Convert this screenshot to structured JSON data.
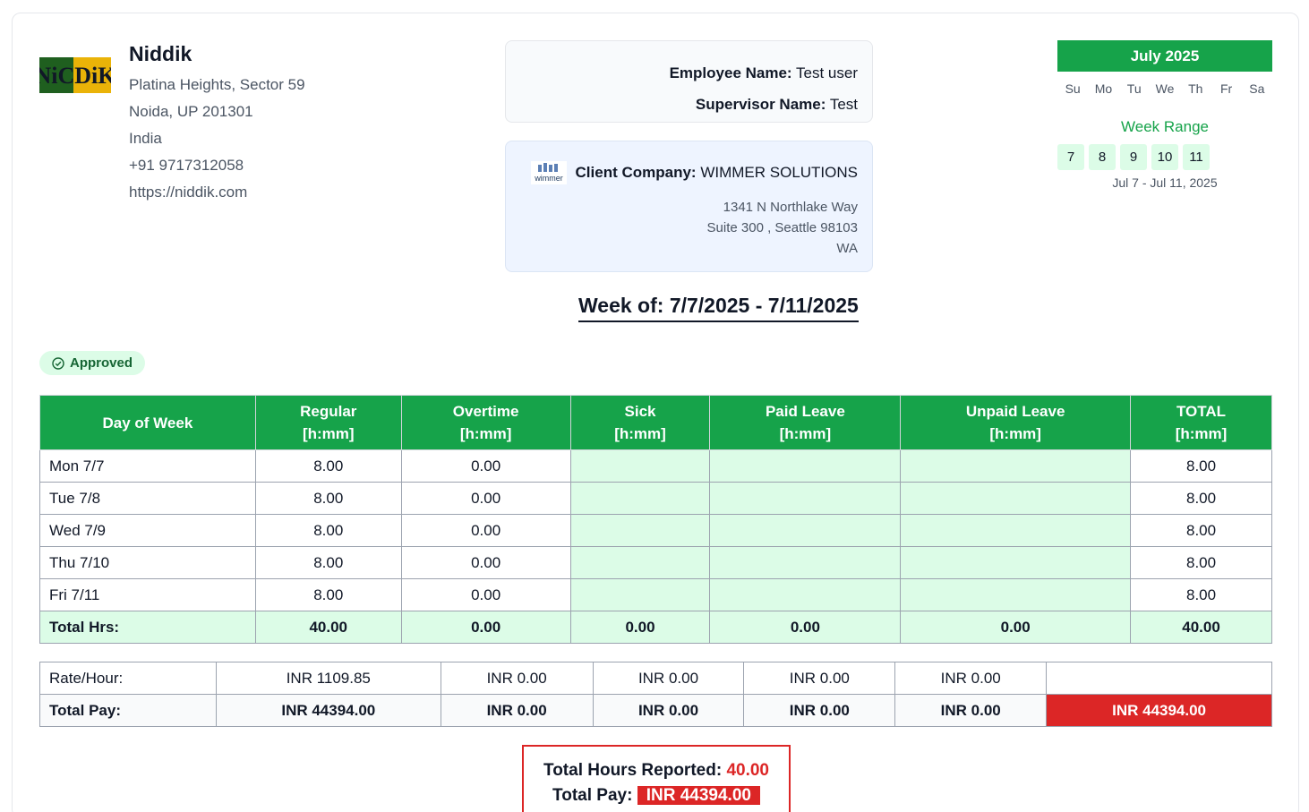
{
  "company": {
    "logo_text": "NiCDiK",
    "name": "Niddik",
    "address_line1": "Platina Heights, Sector 59",
    "address_line2": "Noida, UP 201301",
    "country": "India",
    "phone": "+91 9717312058",
    "website": "https://niddik.com"
  },
  "employee": {
    "employee_label": "Employee Name:",
    "employee_name": "Test user",
    "supervisor_label": "Supervisor Name:",
    "supervisor_name": "Test"
  },
  "client": {
    "logo_text": "wimmer",
    "label": "Client Company:",
    "name": "WIMMER SOLUTIONS",
    "address_line1": "1341 N Northlake Way",
    "address_line2": "Suite 300 , Seattle 98103",
    "address_line3": "WA"
  },
  "week_title": "Week of: 7/7/2025 - 7/11/2025",
  "calendar": {
    "month": "July 2025",
    "weekdays": [
      "Su",
      "Mo",
      "Tu",
      "We",
      "Th",
      "Fr",
      "Sa"
    ],
    "week_range_label": "Week Range",
    "dates": [
      "7",
      "8",
      "9",
      "10",
      "11"
    ],
    "range_text": "Jul 7 - Jul 11, 2025"
  },
  "status": {
    "label": "Approved",
    "icon": "check-circle-icon",
    "color": "#16a34a"
  },
  "hours_table": {
    "headers": [
      {
        "l1": "Day of Week",
        "l2": ""
      },
      {
        "l1": "Regular",
        "l2": "[h:mm]"
      },
      {
        "l1": "Overtime",
        "l2": "[h:mm]"
      },
      {
        "l1": "Sick",
        "l2": "[h:mm]"
      },
      {
        "l1": "Paid Leave",
        "l2": "[h:mm]"
      },
      {
        "l1": "Unpaid Leave",
        "l2": "[h:mm]"
      },
      {
        "l1": "TOTAL",
        "l2": "[h:mm]"
      }
    ],
    "rows": [
      {
        "day": "Mon 7/7",
        "regular": "8.00",
        "overtime": "0.00",
        "sick": "",
        "paid": "",
        "unpaid": "",
        "total": "8.00"
      },
      {
        "day": "Tue 7/8",
        "regular": "8.00",
        "overtime": "0.00",
        "sick": "",
        "paid": "",
        "unpaid": "",
        "total": "8.00"
      },
      {
        "day": "Wed 7/9",
        "regular": "8.00",
        "overtime": "0.00",
        "sick": "",
        "paid": "",
        "unpaid": "",
        "total": "8.00"
      },
      {
        "day": "Thu 7/10",
        "regular": "8.00",
        "overtime": "0.00",
        "sick": "",
        "paid": "",
        "unpaid": "",
        "total": "8.00"
      },
      {
        "day": "Fri 7/11",
        "regular": "8.00",
        "overtime": "0.00",
        "sick": "",
        "paid": "",
        "unpaid": "",
        "total": "8.00"
      }
    ],
    "totals": {
      "label": "Total Hrs:",
      "regular": "40.00",
      "overtime": "0.00",
      "sick": "0.00",
      "paid": "0.00",
      "unpaid": "0.00",
      "total": "40.00"
    }
  },
  "pay_table": {
    "rate_label": "Rate/Hour:",
    "rates": [
      "INR 1109.85",
      "INR 0.00",
      "INR 0.00",
      "INR 0.00",
      "INR 0.00",
      ""
    ],
    "total_label": "Total Pay:",
    "totals": [
      "INR 44394.00",
      "INR 0.00",
      "INR 0.00",
      "INR 0.00",
      "INR 0.00",
      "INR 44394.00"
    ]
  },
  "summary": {
    "hours_label": "Total Hours Reported:",
    "hours_value": "40.00",
    "pay_label": "Total Pay:",
    "pay_value": "INR 44394.00"
  },
  "colors": {
    "accent": "#16a34a",
    "danger": "#dc2626",
    "leave_bg": "#dcfce7"
  }
}
